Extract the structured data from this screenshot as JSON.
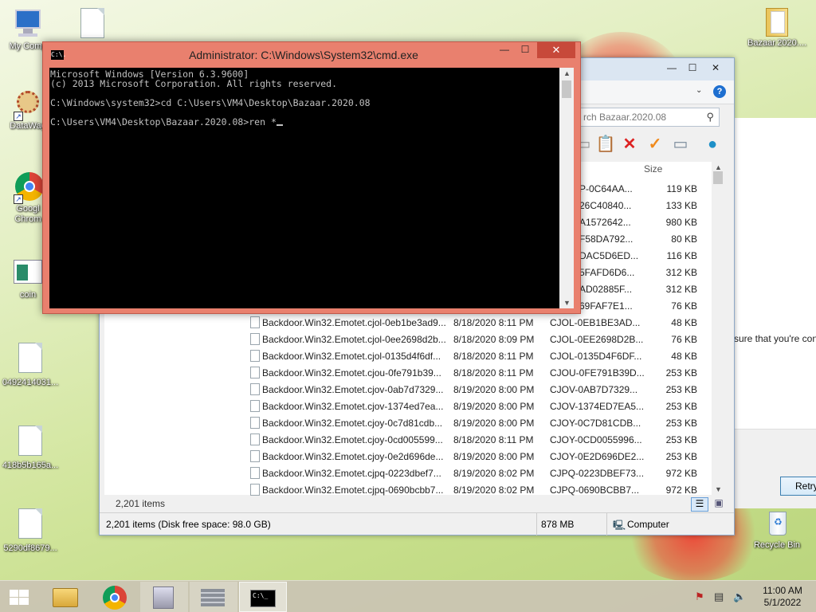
{
  "desktop": {
    "icons": [
      {
        "label": "My Comp"
      },
      {
        "label": "DataWag"
      },
      {
        "label": "Googl Chrom"
      },
      {
        "label": "coin"
      },
      {
        "label": "0492414031..."
      },
      {
        "label": "418b5b165a..."
      },
      {
        "label": "5290df8679..."
      },
      {
        "label": "Bazaar.2020...."
      },
      {
        "label": "Recycle Bin"
      }
    ]
  },
  "cmd": {
    "title": "Administrator: C:\\Windows\\System32\\cmd.exe",
    "icon_text": "C:\\.",
    "lines": [
      "Microsoft Windows [Version 6.3.9600]",
      "(c) 2013 Microsoft Corporation. All rights reserved.",
      "",
      "C:\\Windows\\system32>cd C:\\Users\\VM4\\Desktop\\Bazaar.2020.08",
      "",
      "C:\\Users\\VM4\\Desktop\\Bazaar.2020.08>ren *"
    ],
    "controls": {
      "minimize": "—",
      "maximize": "☐",
      "close": "✕"
    }
  },
  "explorer": {
    "search_placeholder": "rch Bazaar.2020.08",
    "column_size": "Size",
    "partial_rows": [
      {
        "type": "P-0C64AA...",
        "size": "119 KB"
      },
      {
        "type": "26C40840...",
        "size": "133 KB"
      },
      {
        "type": "A1572642...",
        "size": "980 KB"
      },
      {
        "type": "F58DA792...",
        "size": "80 KB"
      },
      {
        "type": "DAC5D6ED...",
        "size": "116 KB"
      },
      {
        "type": "5FAFD6D6...",
        "size": "312 KB"
      },
      {
        "type": "AD02885F...",
        "size": "312 KB"
      },
      {
        "type": "69FAF7E1...",
        "size": "76 KB"
      }
    ],
    "rows": [
      {
        "name": "Backdoor.Win32.Emotet.cjol-0eb1be3ad9...",
        "date": "8/18/2020 8:11 PM",
        "type": "CJOL-0EB1BE3AD...",
        "size": "48 KB"
      },
      {
        "name": "Backdoor.Win32.Emotet.cjol-0ee2698d2b...",
        "date": "8/18/2020 8:09 PM",
        "type": "CJOL-0EE2698D2B...",
        "size": "76 KB"
      },
      {
        "name": "Backdoor.Win32.Emotet.cjol-0135d4f6df...",
        "date": "8/18/2020 8:11 PM",
        "type": "CJOL-0135D4F6DF...",
        "size": "48 KB"
      },
      {
        "name": "Backdoor.Win32.Emotet.cjou-0fe791b39...",
        "date": "8/18/2020 8:11 PM",
        "type": "CJOU-0FE791B39D...",
        "size": "253 KB"
      },
      {
        "name": "Backdoor.Win32.Emotet.cjov-0ab7d7329...",
        "date": "8/19/2020 8:00 PM",
        "type": "CJOV-0AB7D7329...",
        "size": "253 KB"
      },
      {
        "name": "Backdoor.Win32.Emotet.cjov-1374ed7ea...",
        "date": "8/19/2020 8:00 PM",
        "type": "CJOV-1374ED7EA5...",
        "size": "253 KB"
      },
      {
        "name": "Backdoor.Win32.Emotet.cjoy-0c7d81cdb...",
        "date": "8/19/2020 8:00 PM",
        "type": "CJOY-0C7D81CDB...",
        "size": "253 KB"
      },
      {
        "name": "Backdoor.Win32.Emotet.cjoy-0cd005599...",
        "date": "8/18/2020 8:11 PM",
        "type": "CJOY-0CD0055996...",
        "size": "253 KB"
      },
      {
        "name": "Backdoor.Win32.Emotet.cjoy-0e2d696de...",
        "date": "8/19/2020 8:00 PM",
        "type": "CJOY-0E2D696DE2...",
        "size": "253 KB"
      },
      {
        "name": "Backdoor.Win32.Emotet.cjpq-0223dbef7...",
        "date": "8/19/2020 8:02 PM",
        "type": "CJPQ-0223DBEF73...",
        "size": "972 KB"
      },
      {
        "name": "Backdoor.Win32.Emotet.cjpq-0690bcbb7...",
        "date": "8/19/2020 8:02 PM",
        "type": "CJPQ-0690BCBB7...",
        "size": "972 KB"
      }
    ],
    "items_count": "2,201 items",
    "status_left": "2,201 items (Disk free space: 98.0 GB)",
    "status_size": "878 MB",
    "status_location": "Computer"
  },
  "dialog": {
    "text": "sure that you're con",
    "retry_label": "Retry"
  },
  "taskbar": {
    "time": "11:00 AM",
    "date": "5/1/2022"
  },
  "colors": {
    "cmd_frame": "#e9806e",
    "cmd_bg": "#000000",
    "cmd_text": "#c0c0c0",
    "taskbar": "#cac4b4"
  }
}
